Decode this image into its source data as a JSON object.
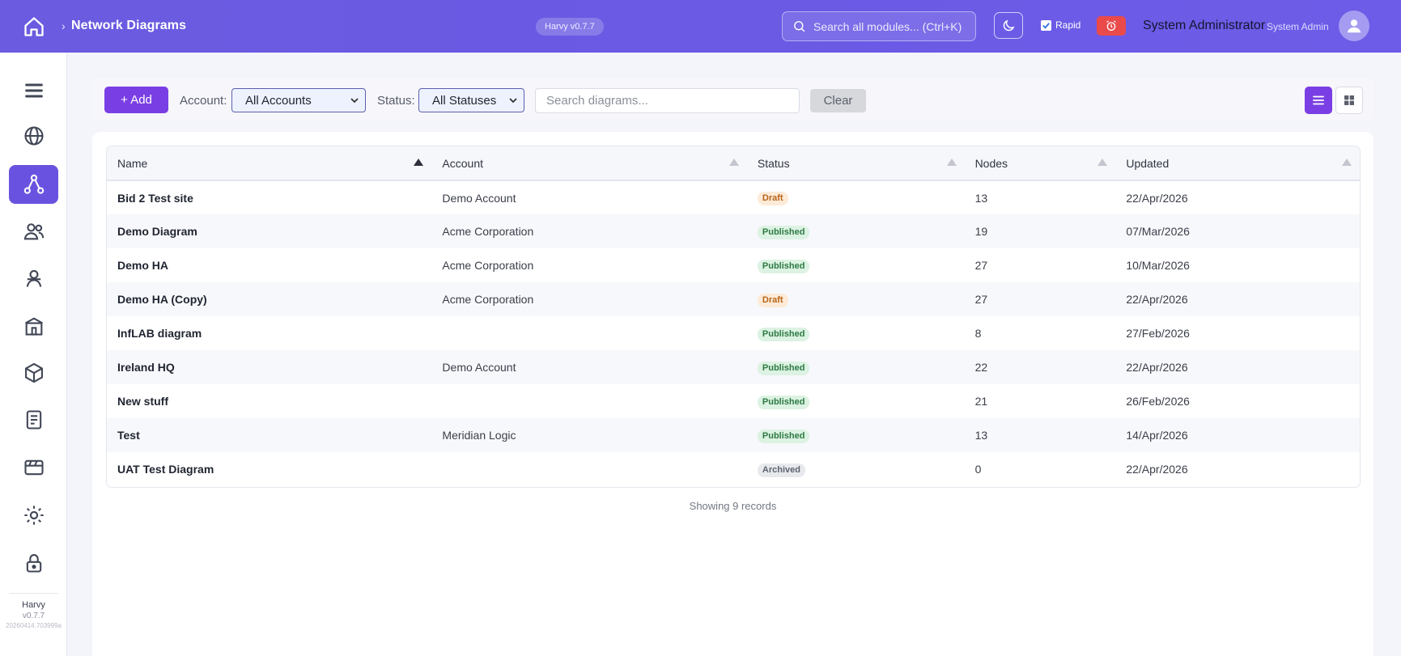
{
  "header": {
    "breadcrumb_sep": "›",
    "title": "Network Diagrams",
    "version": "Harvy v0.7.7",
    "search_placeholder": "Search all modules... (Ctrl+K)",
    "rapid_label": "Rapid",
    "user_name": "System Administrator",
    "user_role": "System Admin"
  },
  "sidebar": {
    "items": [
      {
        "icon": "menu-icon"
      },
      {
        "icon": "globe-icon"
      },
      {
        "icon": "network-icon",
        "active": true
      },
      {
        "icon": "users-icon"
      },
      {
        "icon": "user-icon"
      },
      {
        "icon": "building-icon"
      },
      {
        "icon": "cube-icon"
      },
      {
        "icon": "document-icon"
      },
      {
        "icon": "card-icon"
      },
      {
        "icon": "settings-icon"
      },
      {
        "icon": "lock-icon"
      }
    ],
    "brand": "Harvy",
    "version": "v0.7.7",
    "build": "20260414.703999a"
  },
  "toolbar": {
    "add_label": "+ Add",
    "account_label": "Account:",
    "account_value": "All Accounts",
    "status_label": "Status:",
    "status_value": "All Statuses",
    "search_placeholder": "Search diagrams...",
    "clear_label": "Clear"
  },
  "table": {
    "columns": [
      "Name",
      "Account",
      "Status",
      "Nodes",
      "Updated"
    ],
    "rows": [
      {
        "name": "Bid 2 Test site",
        "account": "Demo Account",
        "status": "Draft",
        "nodes": "13",
        "updated": "22/Apr/2026"
      },
      {
        "name": "Demo Diagram",
        "account": "Acme Corporation",
        "status": "Published",
        "nodes": "19",
        "updated": "07/Mar/2026"
      },
      {
        "name": "Demo HA",
        "account": "Acme Corporation",
        "status": "Published",
        "nodes": "27",
        "updated": "10/Mar/2026"
      },
      {
        "name": "Demo HA (Copy)",
        "account": "Acme Corporation",
        "status": "Draft",
        "nodes": "27",
        "updated": "22/Apr/2026"
      },
      {
        "name": "InfLAB diagram",
        "account": "",
        "status": "Published",
        "nodes": "8",
        "updated": "27/Feb/2026"
      },
      {
        "name": "Ireland HQ",
        "account": "Demo Account",
        "status": "Published",
        "nodes": "22",
        "updated": "22/Apr/2026"
      },
      {
        "name": "New stuff",
        "account": "",
        "status": "Published",
        "nodes": "21",
        "updated": "26/Feb/2026"
      },
      {
        "name": "Test",
        "account": "Meridian Logic",
        "status": "Published",
        "nodes": "13",
        "updated": "14/Apr/2026"
      },
      {
        "name": "UAT Test Diagram",
        "account": "",
        "status": "Archived",
        "nodes": "0",
        "updated": "22/Apr/2026"
      }
    ]
  },
  "footer": {
    "count_text": "Showing 9 records"
  },
  "colors": {
    "accent": "#6a52e0",
    "button": "#7a3fe4",
    "alarm": "#ea4a4a"
  }
}
